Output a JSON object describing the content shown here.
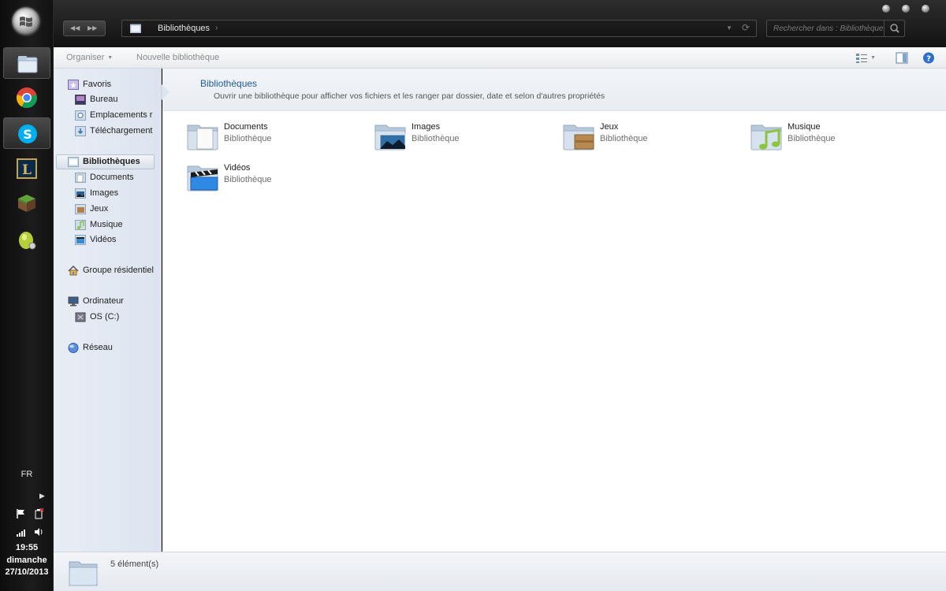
{
  "taskbar": {
    "apps": [
      {
        "name": "explorer",
        "active": true
      },
      {
        "name": "chrome",
        "active": false
      },
      {
        "name": "skype",
        "active": true
      },
      {
        "name": "league-of-legends",
        "active": false
      },
      {
        "name": "minecraft",
        "active": false
      },
      {
        "name": "egg-app",
        "active": false
      }
    ],
    "tray": {
      "language": "FR",
      "time": "19:55",
      "day": "dimanche",
      "date": "27/10/2013"
    }
  },
  "address": {
    "path": "Bibliothèques",
    "separator": "›",
    "search_placeholder": "Rechercher dans : Bibliothèques"
  },
  "toolbar": {
    "organize": "Organiser",
    "new_library": "Nouvelle bibliothèque"
  },
  "nav": {
    "favorites": "Favoris",
    "desktop": "Bureau",
    "recent_places": "Emplacements r",
    "downloads": "Téléchargement",
    "libraries": "Bibliothèques",
    "documents": "Documents",
    "images": "Images",
    "games": "Jeux",
    "music": "Musique",
    "videos": "Vidéos",
    "homegroup": "Groupe résidentiel",
    "computer": "Ordinateur",
    "drive_c": "OS (C:)",
    "network": "Réseau"
  },
  "content": {
    "title": "Bibliothèques",
    "description": "Ouvrir une bibliothèque pour afficher vos fichiers et les ranger par dossier, date et selon d'autres propriétés",
    "libraries": [
      {
        "name": "Documents",
        "type": "Bibliothèque"
      },
      {
        "name": "Images",
        "type": "Bibliothèque"
      },
      {
        "name": "Jeux",
        "type": "Bibliothèque"
      },
      {
        "name": "Musique",
        "type": "Bibliothèque"
      },
      {
        "name": "Vidéos",
        "type": "Bibliothèque"
      }
    ]
  },
  "status": {
    "count": "5 élément(s)"
  },
  "colors": {
    "accent_title": "#1e5b94",
    "nav_bg": "#e8edf5",
    "chrome_dark": "#1a1a1a"
  }
}
